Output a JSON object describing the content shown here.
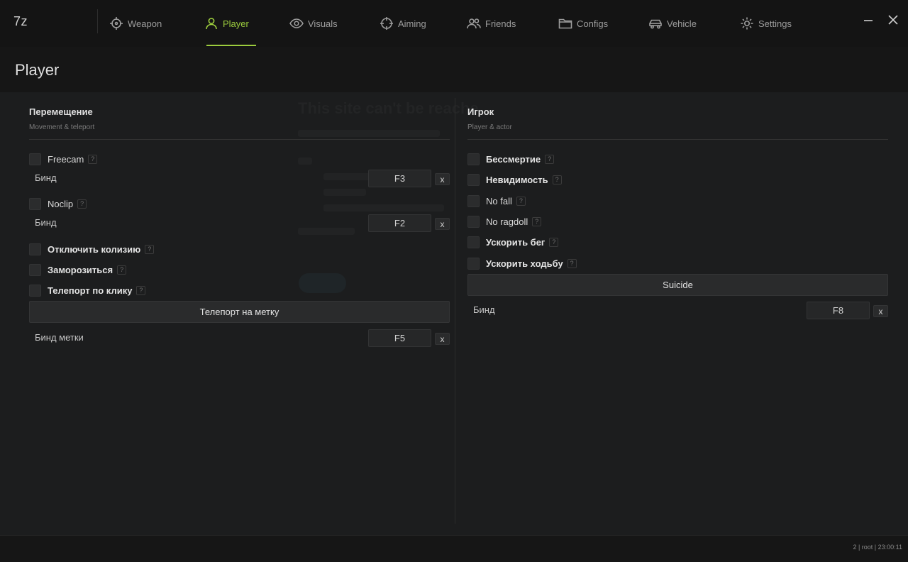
{
  "app": {
    "logo": "7z"
  },
  "nav": {
    "tabs": [
      {
        "label": "Weapon",
        "icon": "crosshair-icon"
      },
      {
        "label": "Player",
        "icon": "user-icon",
        "active": true
      },
      {
        "label": "Visuals",
        "icon": "eye-icon"
      },
      {
        "label": "Aiming",
        "icon": "target-icon"
      },
      {
        "label": "Friends",
        "icon": "users-icon"
      },
      {
        "label": "Configs",
        "icon": "folder-icon"
      },
      {
        "label": "Vehicle",
        "icon": "car-icon"
      },
      {
        "label": "Settings",
        "icon": "gear-icon"
      }
    ]
  },
  "page": {
    "title": "Player"
  },
  "left": {
    "title": "Перемещение",
    "subtitle": "Movement & teleport",
    "freecam_label": "Freecam",
    "freecam_bind_label": "Бинд",
    "freecam_bind_key": "F3",
    "noclip_label": "Noclip",
    "noclip_bind_label": "Бинд",
    "noclip_bind_key": "F2",
    "collision_label": "Отключить колизию",
    "freeze_label": "Заморозиться",
    "click_tp_label": "Телепорт по клику",
    "tp_marker_button": "Телепорт на метку",
    "marker_bind_label": "Бинд метки",
    "marker_bind_key": "F5",
    "clear_label": "x",
    "help_label": "?"
  },
  "right": {
    "title": "Игрок",
    "subtitle": "Player & actor",
    "godmode_label": "Бессмертие",
    "invisible_label": "Невидимость",
    "nofall_label": "No fall",
    "noragdoll_label": "No ragdoll",
    "fastrun_label": "Ускорить бег",
    "fastwalk_label": "Ускорить ходьбу",
    "suicide_button": "Suicide",
    "suicide_bind_label": "Бинд",
    "suicide_bind_key": "F8",
    "clear_label": "x",
    "help_label": "?"
  },
  "background_page": {
    "title": "This site can't be reache"
  },
  "footer": {
    "status": "2 | root | 23:00:11"
  },
  "colors": {
    "accent": "#9ccc3d",
    "bg": "#1c1d1e",
    "topbar": "#141414"
  }
}
